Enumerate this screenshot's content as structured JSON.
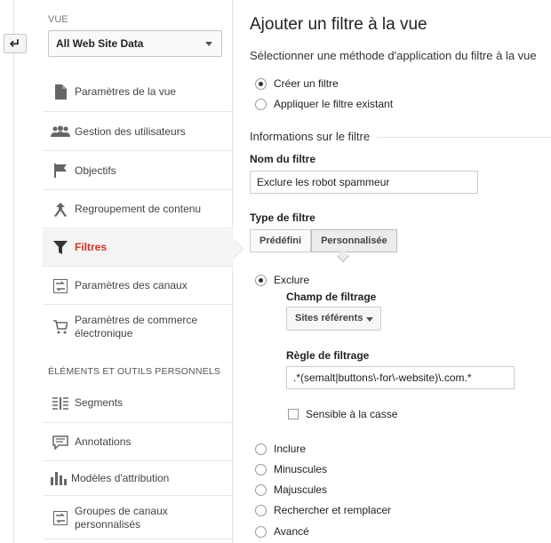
{
  "sidebar": {
    "vue_label": "VUE",
    "view_select": "All Web Site Data",
    "items": [
      {
        "label": "Paramètres de la vue",
        "icon": "document-icon"
      },
      {
        "label": "Gestion des utilisateurs",
        "icon": "users-icon"
      },
      {
        "label": "Objectifs",
        "icon": "flag-icon"
      },
      {
        "label": "Regroupement de contenu",
        "icon": "merge-icon"
      },
      {
        "label": "Filtres",
        "icon": "filter-icon",
        "active": true
      },
      {
        "label": "Paramètres des canaux",
        "icon": "channels-icon"
      },
      {
        "label": "Paramètres de commerce électronique",
        "icon": "cart-icon"
      }
    ],
    "section_title": "ÉLÉMENTS ET OUTILS PERSONNELS",
    "tools": [
      {
        "label": "Segments",
        "icon": "segments-icon"
      },
      {
        "label": "Annotations",
        "icon": "annotation-icon"
      },
      {
        "label": "Modèles d'attribution",
        "icon": "bar-chart-icon"
      },
      {
        "label": "Groupes de canaux personnalisés",
        "icon": "channel-groups-icon"
      }
    ]
  },
  "main": {
    "title": "Ajouter un filtre à la vue",
    "subtitle": "Sélectionner une méthode d'application du filtre à la vue",
    "method_options": [
      "Créer un filtre",
      "Appliquer le filtre existant"
    ],
    "method_selected": 0,
    "info_heading": "Informations sur le filtre",
    "name_label": "Nom du filtre",
    "name_value": "Exclure les robot spammeur",
    "type_label": "Type de filtre",
    "type_tabs": [
      "Prédéfini",
      "Personnalisée"
    ],
    "type_selected": 1,
    "exclude_label": "Exclure",
    "field_label": "Champ de filtrage",
    "field_value": "Sites référents",
    "rule_label": "Règle de filtrage",
    "rule_value": ".*(semalt|buttons\\-for\\-website)\\.com.*",
    "case_label": "Sensible à la casse",
    "other_options": [
      "Inclure",
      "Minuscules",
      "Majuscules",
      "Rechercher et remplacer",
      "Avancé"
    ]
  },
  "colors": {
    "accent": "#d93025",
    "border": "#cccccc"
  }
}
